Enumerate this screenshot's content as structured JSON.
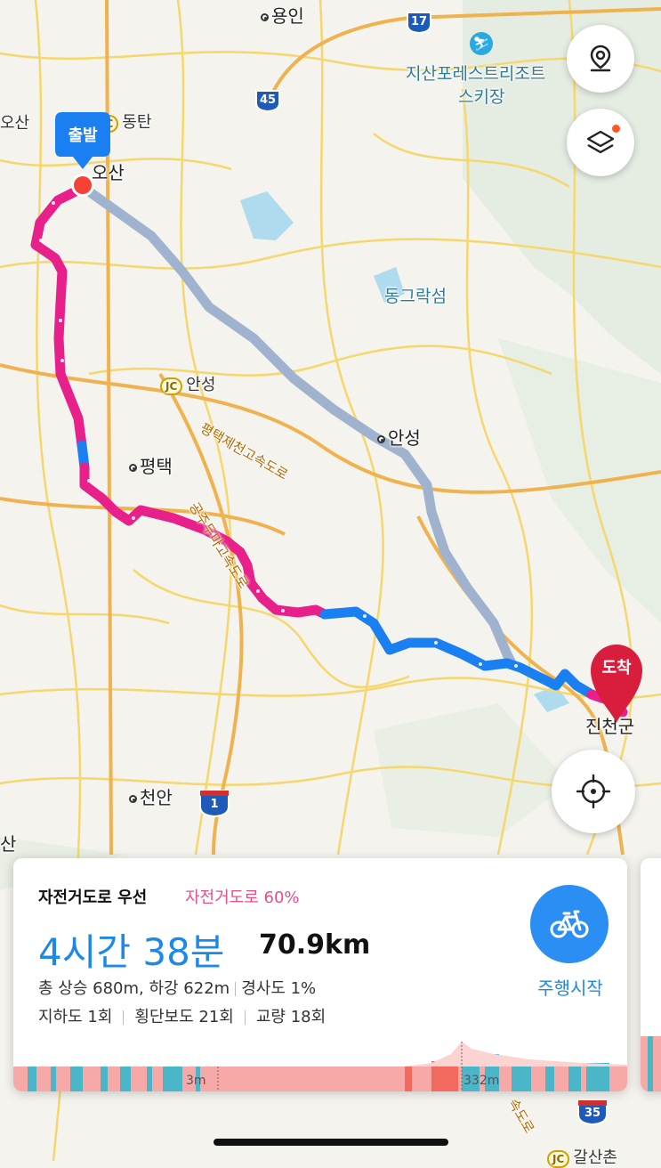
{
  "map": {
    "places": {
      "yongin": "용인",
      "jisan": "지산포레스트리조트",
      "jisan2": "스키장",
      "osan_left": "오산",
      "dongtan": "동탄",
      "osan": "오산",
      "donggeuraksum": "동그락섬",
      "anseong_jc": "안성",
      "anseong": "안성",
      "pyeongtaek": "평택",
      "highway1": "평택제천고속도로",
      "highway2": "공주두마고속도로",
      "jincheon": "진천군",
      "cheonan": "천안",
      "san_left": "산",
      "gasa": "갈산촌",
      "doro": "속도로",
      "jc": "JC"
    },
    "highway_shields": [
      "17",
      "45",
      "1",
      "35"
    ],
    "start_marker": "출발",
    "end_marker": "도착",
    "colors": {
      "bike_lane": "#e8208a",
      "road": "#1a7ff0",
      "alt_route": "#9fb3cf"
    }
  },
  "buttons": {
    "map_mode_icon": "map-pin-icon",
    "layers_icon": "layers-icon",
    "location_icon": "crosshair-icon"
  },
  "route_card": {
    "title": "자전거도로 우선",
    "bike_ratio": "자전거도로 60%",
    "duration": "4시간 38분",
    "distance": "70.9km",
    "elevation": "총 상승 680m, 하강 622m",
    "slope": "경사도 1%",
    "underpass": "지하도 1회",
    "crosswalk": "횡단보도 21회",
    "bridge": "교량 18회",
    "start_label": "주행시작",
    "elev_min_label": "3m",
    "elev_max_label": "332m"
  }
}
